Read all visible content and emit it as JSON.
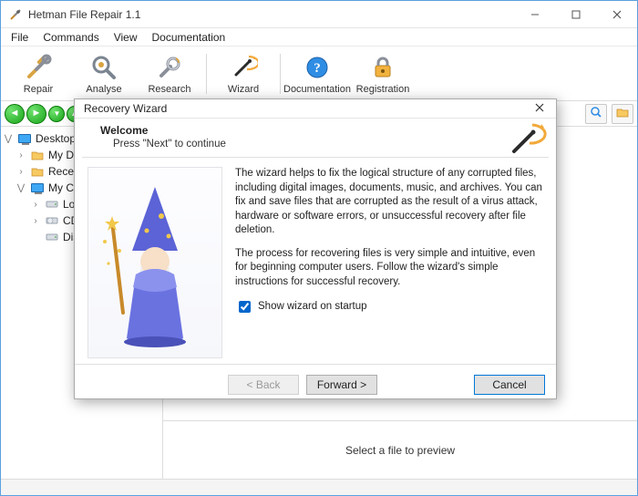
{
  "window": {
    "title": "Hetman File Repair 1.1",
    "min_tip": "Minimize",
    "max_tip": "Maximize",
    "close_tip": "Close"
  },
  "menu": {
    "file": "File",
    "commands": "Commands",
    "view": "View",
    "documentation": "Documentation"
  },
  "toolbar": {
    "repair": "Repair",
    "analyse": "Analyse",
    "research": "Research",
    "wizard": "Wizard",
    "documentation": "Documentation",
    "registration": "Registration"
  },
  "nav": {
    "back_tip": "Back",
    "forward_tip": "Forward",
    "recent_tip": "Recent",
    "up_tip": "Up",
    "search_tip": "Search",
    "view_tip": "View options"
  },
  "tree": {
    "desktop": "Desktop",
    "mydocs": "My Documents",
    "recentdocs": "Recent Documents",
    "mycomputer": "My Computer",
    "localdisk": "Local Disk (C:)",
    "cddrive": "CD Drive (D:)",
    "diskf": "Disk (F:)"
  },
  "preview": {
    "placeholder": "Select a file to preview"
  },
  "dialog": {
    "title": "Recovery Wizard",
    "heading": "Welcome",
    "subheading": "Press \"Next\" to continue",
    "para1": "The wizard helps to fix the logical structure of any corrupted files, including digital images, documents, music, and archives. You can fix and save files that are corrupted as the result of a virus attack, hardware or software errors, or unsuccessful recovery after file deletion.",
    "para2": "The process for recovering files is very simple and intuitive, even for beginning computer users. Follow the wizard's simple instructions for successful recovery.",
    "checkbox_label": "Show wizard on startup",
    "back": "< Back",
    "forward": "Forward >",
    "cancel": "Cancel"
  }
}
